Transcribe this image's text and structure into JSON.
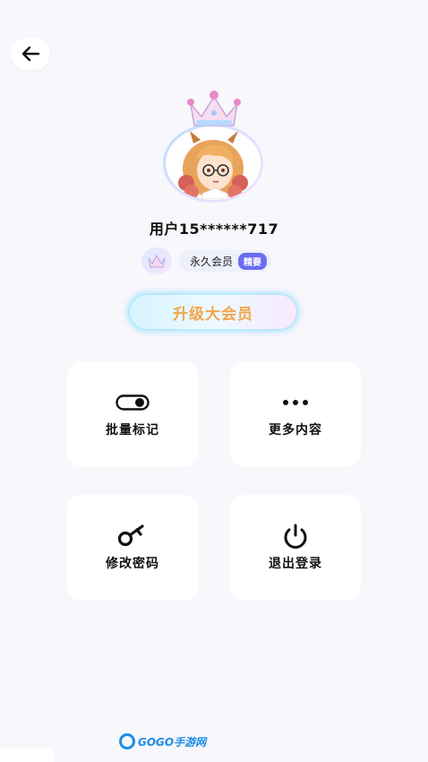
{
  "header": {
    "back_icon": "arrow-left-icon"
  },
  "profile": {
    "username": "用户15******717",
    "avatar_icon": "anime-girl-avatar",
    "crown_icon": "crown-icon",
    "membership_label": "永久会员",
    "membership_badge": "精要"
  },
  "upgrade": {
    "label": "升级大会员",
    "color": "#f3a54a"
  },
  "menu": [
    {
      "label": "批量标记",
      "icon": "toggle-icon"
    },
    {
      "label": "更多内容",
      "icon": "more-dots-icon"
    },
    {
      "label": "修改密码",
      "icon": "key-icon"
    },
    {
      "label": "退出登录",
      "icon": "power-icon"
    }
  ],
  "watermark": {
    "text": "GOGO手游网"
  }
}
